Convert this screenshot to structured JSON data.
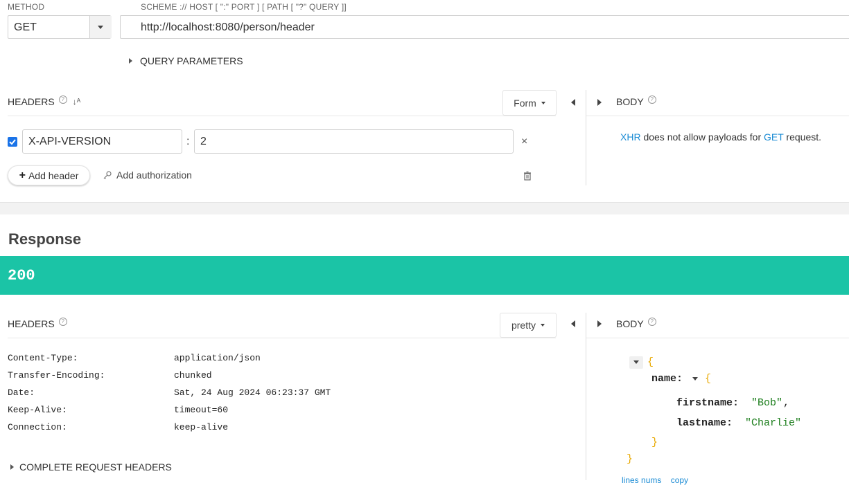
{
  "request": {
    "method_label": "METHOD",
    "method_value": "GET",
    "url_label": "SCHEME :// HOST [ \":\" PORT ] [ PATH [ \"?\" QUERY ]]",
    "url_value": "http://localhost:8080/person/header",
    "query_params_label": "QUERY PARAMETERS",
    "headers_label": "HEADERS",
    "form_label": "Form",
    "header_row": {
      "name": "X-API-VERSION",
      "separator": ":",
      "value": "2"
    },
    "add_header_label": "Add header",
    "add_auth_label": "Add authorization",
    "body_label": "BODY",
    "body_message": {
      "xhr": "XHR",
      "middle": " does not allow payloads for ",
      "method": "GET",
      "end": " request."
    }
  },
  "response": {
    "title": "Response",
    "status_code": "200",
    "status_color": "#1bc4a6",
    "headers_label": "HEADERS",
    "pretty_label": "pretty",
    "headers": [
      {
        "name": "Content-Type:",
        "value": "application/json"
      },
      {
        "name": "Transfer-Encoding:",
        "value": "chunked"
      },
      {
        "name": "Date:",
        "value": "Sat, 24 Aug 2024 06:23:37 GMT"
      },
      {
        "name": "Keep-Alive:",
        "value": "timeout=60"
      },
      {
        "name": "Connection:",
        "value": "keep-alive"
      }
    ],
    "complete_headers_label": "COMPLETE REQUEST HEADERS",
    "body_label": "BODY",
    "json": {
      "open_brace": "{",
      "name_key": "name:",
      "firstname_key": "firstname:",
      "firstname_value": "\"Bob\"",
      "comma": ",",
      "lastname_key": "lastname:",
      "lastname_value": "\"Charlie\"",
      "close_brace": "}"
    },
    "footer_links": {
      "line_numbers": "lines nums",
      "copy": "copy"
    }
  },
  "colors": {
    "accent": "#1bc4a6",
    "link": "#1a8bd4",
    "brace": "#e8a800",
    "string": "#1b7d1b"
  }
}
